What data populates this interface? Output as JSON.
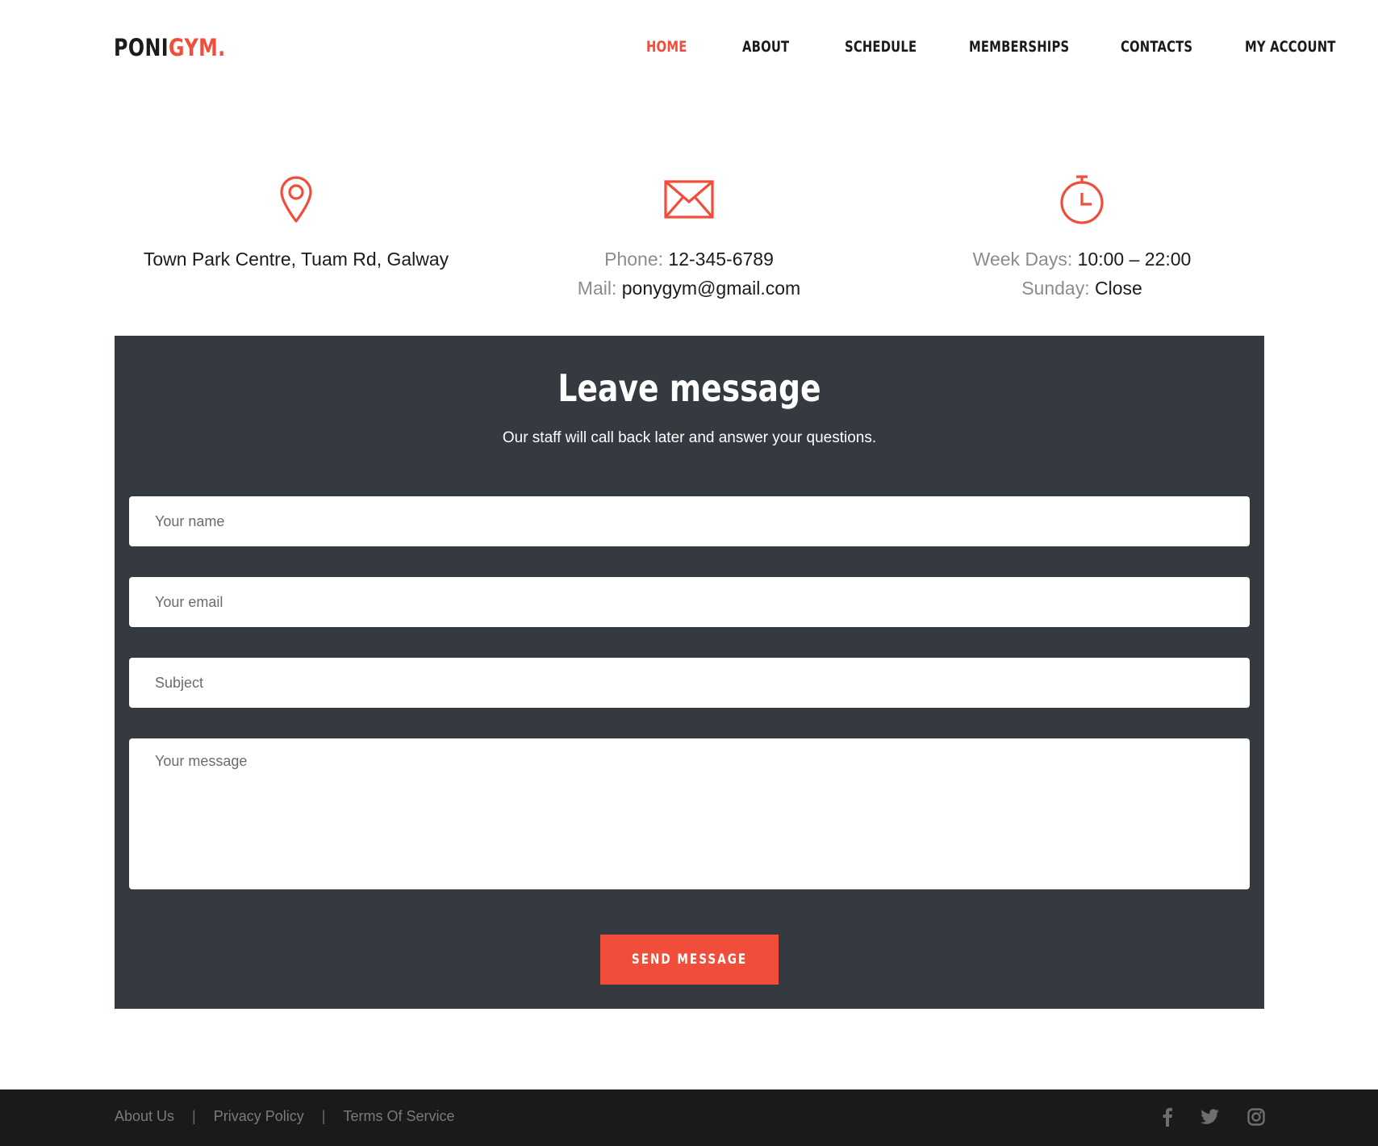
{
  "logo": {
    "part1": "PONI",
    "part2": "GYM."
  },
  "nav": [
    {
      "label": "HOME",
      "active": true
    },
    {
      "label": "ABOUT",
      "active": false
    },
    {
      "label": "SCHEDULE",
      "active": false
    },
    {
      "label": "MEMBERSHIPS",
      "active": false
    },
    {
      "label": "CONTACTS",
      "active": false
    },
    {
      "label": "MY ACCOUNT",
      "active": false
    }
  ],
  "info": {
    "address": {
      "icon": "map-pin-icon",
      "text": "Town Park Centre, Tuam Rd, Galway"
    },
    "contact": {
      "icon": "envelope-icon",
      "phone_label": "Phone:",
      "phone_value": "12-345-6789",
      "mail_label": "Mail:",
      "mail_value": "ponygym@gmail.com"
    },
    "hours": {
      "icon": "stopwatch-icon",
      "weekdays_label": "Week Days:",
      "weekdays_value": "10:00 – 22:00",
      "sunday_label": "Sunday:",
      "sunday_value": "Close"
    }
  },
  "form": {
    "title": "Leave message",
    "subtitle": "Our staff will call back later and answer your questions.",
    "name_placeholder": "Your name",
    "email_placeholder": "Your email",
    "subject_placeholder": "Subject",
    "message_placeholder": "Your message",
    "submit_label": "SEND MESSAGE"
  },
  "footer": {
    "links": [
      "About Us",
      "Privacy Policy",
      "Terms Of Service"
    ],
    "separator": "|",
    "social": [
      "facebook-icon",
      "twitter-icon",
      "instagram-icon"
    ]
  },
  "colors": {
    "accent": "#f04e3a",
    "panel": "#353940",
    "footer": "#1a1a1a"
  }
}
